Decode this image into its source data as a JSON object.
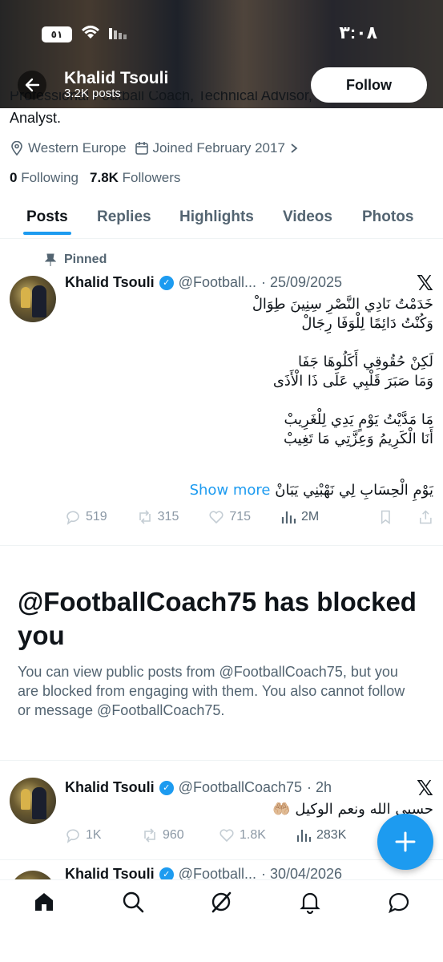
{
  "status_bar": {
    "time": "٣:٠٨",
    "battery": "٥١"
  },
  "profile": {
    "name": "Khalid Tsouli",
    "post_count": "3.2K posts",
    "follow_label": "Follow",
    "bio_cut": "Professional Football Coach, Technical Advisor, and Video",
    "bio_line": "Analyst.",
    "location": "Western Europe",
    "joined": "Joined February 2017",
    "following_count": "0",
    "following_label": "Following",
    "followers_count": "7.8K",
    "followers_label": "Followers"
  },
  "tabs": [
    "Posts",
    "Replies",
    "Highlights",
    "Videos",
    "Photos"
  ],
  "pinned_post": {
    "pinned_label": "Pinned",
    "name": "Khalid Tsouli",
    "handle": "@Football...",
    "date": "· 25/09/2025",
    "text": "خَدَمْتُ نَادِي النَّصْرِ سِنِينَ طِوَالْ\nوَكُنْتُ دَائِمًا لِلْوَفَا رِجَالْ\n\nلَكِنْ حُقُوقِي أَكَلُوهَا جَفَا\nوَمَا صَبَرَ قَلْبِي عَلَى ذَا الْأَذَى\n\nمَا مَدَّيْتُ يَوْمٍ يَدِي لِلْغَرِيبْ\nأَنَا الْكَرِيمُ وَعِزَّتِي مَا تَغِيبْ",
    "last_line": "يَوْمِ الْحِسَابِ لِي نَهْبْنِي يَبَانْ",
    "show_more": "Show more",
    "replies": "519",
    "reposts": "315",
    "likes": "715",
    "views": "2M"
  },
  "blocked": {
    "title": "@FootballCoach75 has blocked you",
    "text": "You can view public posts from @FootballCoach75, but you are blocked from engaging with them. You also cannot follow or message @FootballCoach75."
  },
  "post2": {
    "name": "Khalid Tsouli",
    "handle": "@FootballCoach75",
    "time": "· 2h",
    "text": "حسبي الله ونعم الوكيل 🤲🏼",
    "replies": "1K",
    "reposts": "960",
    "likes": "1.8K",
    "views": "283K"
  },
  "post3": {
    "name": "Khalid Tsouli",
    "handle": "@Football...",
    "date": "· 30/04/2026"
  },
  "colors": {
    "accent": "#1d9bf0",
    "text": "#0f1419",
    "muted": "#536471"
  }
}
